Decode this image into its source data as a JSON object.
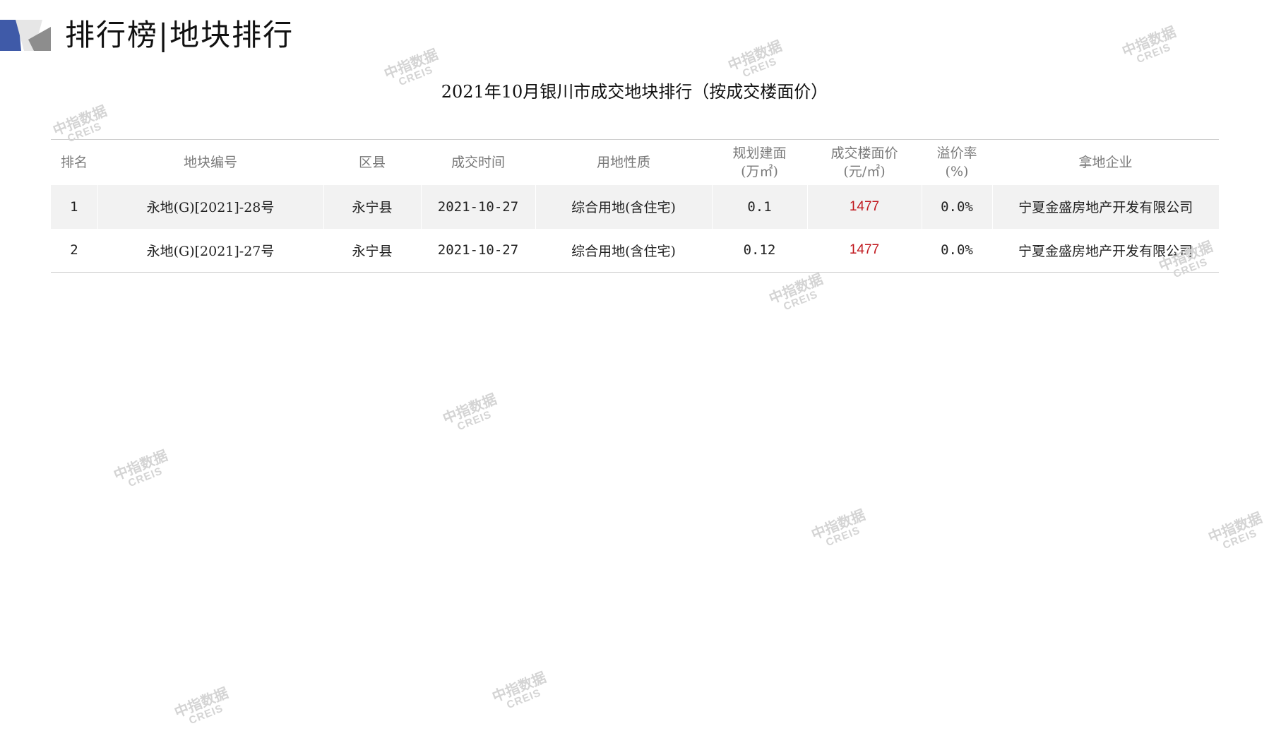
{
  "header": {
    "title": "排行榜|地块排行"
  },
  "table_title": "2021年10月银川市成交地块排行（按成交楼面价）",
  "table": {
    "columns": [
      {
        "line1": "排名",
        "line2": ""
      },
      {
        "line1": "地块编号",
        "line2": ""
      },
      {
        "line1": "区县",
        "line2": ""
      },
      {
        "line1": "成交时间",
        "line2": ""
      },
      {
        "line1": "用地性质",
        "line2": ""
      },
      {
        "line1": "规划建面",
        "line2": "(万㎡)"
      },
      {
        "line1": "成交楼面价",
        "line2": "(元/㎡)"
      },
      {
        "line1": "溢价率",
        "line2": "(%)"
      },
      {
        "line1": "拿地企业",
        "line2": ""
      }
    ],
    "rows": [
      {
        "rank": "1",
        "parcel_id": "永地(G)[2021]-28号",
        "district": "永宁县",
        "date": "2021-10-27",
        "land_use": "综合用地(含住宅)",
        "planned_area": "0.1",
        "floor_price": "1477",
        "premium_rate": "0.0%",
        "company": "宁夏金盛房地产开发有限公司"
      },
      {
        "rank": "2",
        "parcel_id": "永地(G)[2021]-27号",
        "district": "永宁县",
        "date": "2021-10-27",
        "land_use": "综合用地(含住宅)",
        "planned_area": "0.12",
        "floor_price": "1477",
        "premium_rate": "0.0%",
        "company": "宁夏金盛房地产开发有限公司"
      }
    ]
  },
  "watermark": {
    "cn": "中指数据",
    "en": "CREIS"
  },
  "colors": {
    "price_highlight": "#c0161c",
    "header_text": "#7a7a7a",
    "row_stripe": "#f2f2f2",
    "deco_blue": "#3f5aa8",
    "deco_gray": "#8d8d8d"
  }
}
